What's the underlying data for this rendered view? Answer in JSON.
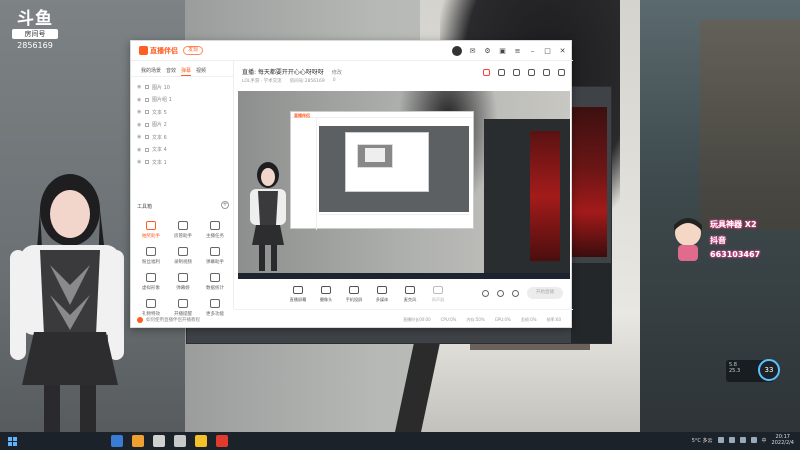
{
  "overlay": {
    "logo_mark": "斗鱼",
    "room_label": "房间号",
    "room_number": "2856169",
    "sticker_line1": "玩具神器 X2",
    "sticker_line2": "抖音",
    "sticker_line3": "663103467",
    "speed_up": "5.8",
    "speed_down": "25.3",
    "speed_value": "33"
  },
  "app": {
    "brand": "直播伴侣",
    "version_button": "发现",
    "tabs": [
      "我的场景",
      "音效",
      "弹幕",
      "视频"
    ],
    "active_tab": 2,
    "scenes": [
      "图片 10",
      "图片组 1",
      "文本 5",
      "图片 2",
      "文本 6",
      "文本 4",
      "文本 1"
    ],
    "tools_title": "工具箱",
    "tools": [
      {
        "label": "抽奖助手",
        "icon": "gift-icon"
      },
      {
        "label": "房管助手",
        "icon": "user-icon"
      },
      {
        "label": "主播任务",
        "icon": "task-icon"
      },
      {
        "label": "粉丝福利",
        "icon": "fans-icon"
      },
      {
        "label": "录制视频",
        "icon": "download-icon"
      },
      {
        "label": "弹幕助手",
        "icon": "image-icon"
      },
      {
        "label": "虚拟形象",
        "icon": "avatar-icon"
      },
      {
        "label": "弹幕姬",
        "icon": "chat-icon"
      },
      {
        "label": "数据统计",
        "icon": "chart-icon"
      },
      {
        "label": "礼物特效",
        "icon": "effect-icon"
      },
      {
        "label": "开播提醒",
        "icon": "bell-icon"
      },
      {
        "label": "更多功能",
        "icon": "more-icon"
      }
    ],
    "hint": "如何使用直播伴侣开播教程",
    "title": "直播: 每天都要开开心心呀呀呀",
    "title_edit": "修改",
    "info": [
      "LOL手游 · 学术交流",
      "房间号:2856169",
      "0"
    ],
    "controls": [
      {
        "label": "直播屏幕",
        "disabled": false
      },
      {
        "label": "摄像头",
        "disabled": false
      },
      {
        "label": "手机投屏",
        "disabled": false
      },
      {
        "label": "多媒体",
        "disabled": false
      },
      {
        "label": "麦克风",
        "disabled": false
      },
      {
        "label": "扬声器",
        "disabled": true
      }
    ],
    "start_button": "开始直播",
    "status": [
      "直播时长00:00",
      "CPU:0%",
      "内存:50%",
      "GPU:0%",
      "丢帧:0%",
      "帧率:60"
    ]
  },
  "taskbar": {
    "weather": "5°C 多云",
    "time": "20:17",
    "date": "2022/2/4",
    "lang": "中"
  }
}
